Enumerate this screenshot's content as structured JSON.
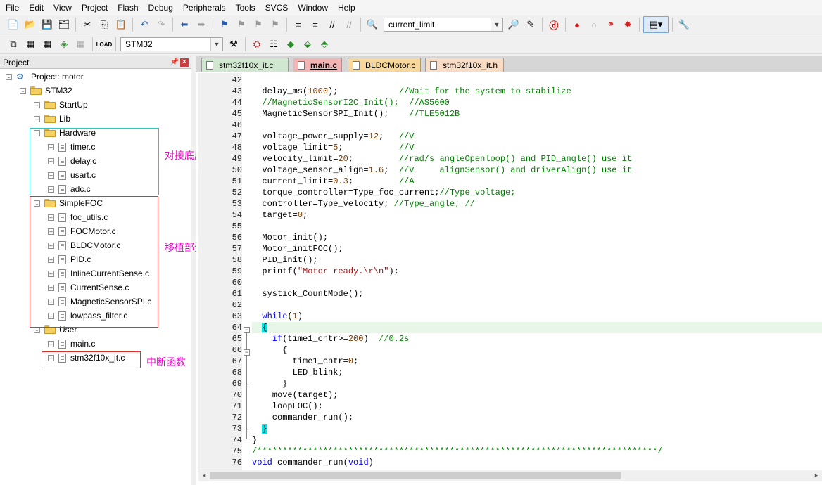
{
  "menu": [
    "File",
    "Edit",
    "View",
    "Project",
    "Flash",
    "Debug",
    "Peripherals",
    "Tools",
    "SVCS",
    "Window",
    "Help"
  ],
  "toolbar1": {
    "find_combo": "current_limit"
  },
  "toolbar2": {
    "target_combo": "STM32"
  },
  "project_panel": {
    "title": "Project",
    "tree": [
      {
        "label": "Project: motor",
        "kind": "project",
        "expander": "-"
      },
      {
        "label": "STM32",
        "kind": "target",
        "expander": "-"
      },
      {
        "label": "StartUp",
        "kind": "folder",
        "expander": "+"
      },
      {
        "label": "Lib",
        "kind": "folder",
        "expander": "+"
      },
      {
        "label": "Hardware",
        "kind": "folder",
        "expander": "-"
      },
      {
        "label": "timer.c",
        "kind": "file",
        "expander": "+"
      },
      {
        "label": "delay.c",
        "kind": "file",
        "expander": "+"
      },
      {
        "label": "usart.c",
        "kind": "file",
        "expander": "+"
      },
      {
        "label": "adc.c",
        "kind": "file",
        "expander": "+"
      },
      {
        "label": "SimpleFOC",
        "kind": "folder",
        "expander": "-"
      },
      {
        "label": "foc_utils.c",
        "kind": "file",
        "expander": "+"
      },
      {
        "label": "FOCMotor.c",
        "kind": "file",
        "expander": "+"
      },
      {
        "label": "BLDCMotor.c",
        "kind": "file",
        "expander": "+"
      },
      {
        "label": "PID.c",
        "kind": "file",
        "expander": "+"
      },
      {
        "label": "InlineCurrentSense.c",
        "kind": "file",
        "expander": "+"
      },
      {
        "label": "CurrentSense.c",
        "kind": "file",
        "expander": "+"
      },
      {
        "label": "MagneticSensorSPI.c",
        "kind": "file",
        "expander": "+"
      },
      {
        "label": "lowpass_filter.c",
        "kind": "file",
        "expander": "+"
      },
      {
        "label": "User",
        "kind": "folder",
        "expander": "-"
      },
      {
        "label": "main.c",
        "kind": "file",
        "expander": "+"
      },
      {
        "label": "stm32f10x_it.c",
        "kind": "file",
        "expander": "+"
      }
    ],
    "annotations": {
      "hardware": "对接底层",
      "simplefoc": "移植部分",
      "interrupt": "中断函数"
    }
  },
  "tabs": [
    {
      "label": "stm32f10x_it.c",
      "style": "green"
    },
    {
      "label": "main.c",
      "style": "active"
    },
    {
      "label": "BLDCMotor.c",
      "style": "orange"
    },
    {
      "label": "stm32f10x_it.h",
      "style": "peach"
    }
  ],
  "line_numbers": [
    "42",
    "43",
    "44",
    "45",
    "46",
    "47",
    "48",
    "49",
    "50",
    "51",
    "52",
    "53",
    "54",
    "55",
    "56",
    "57",
    "58",
    "59",
    "60",
    "61",
    "62",
    "63",
    "64",
    "65",
    "66",
    "67",
    "68",
    "69",
    "70",
    "71",
    "72",
    "73",
    "74",
    "75",
    "76"
  ],
  "code": [
    [],
    [
      [
        "  delay_ms(",
        ""
      ],
      [
        "1000",
        "num"
      ],
      [
        ");            ",
        ""
      ],
      [
        "//Wait for the system to stabilize",
        "cm"
      ]
    ],
    [
      [
        "  ",
        ""
      ],
      [
        "//MagneticSensorI2C_Init();  //AS5600",
        "cm"
      ]
    ],
    [
      [
        "  MagneticSensorSPI_Init();    ",
        ""
      ],
      [
        "//TLE5012B",
        "cm"
      ]
    ],
    [],
    [
      [
        "  voltage_power_supply=",
        ""
      ],
      [
        "12",
        "num"
      ],
      [
        ";   ",
        ""
      ],
      [
        "//V",
        "cm"
      ]
    ],
    [
      [
        "  voltage_limit=",
        ""
      ],
      [
        "5",
        "num"
      ],
      [
        ";           ",
        ""
      ],
      [
        "//V",
        "cm"
      ]
    ],
    [
      [
        "  velocity_limit=",
        ""
      ],
      [
        "20",
        "num"
      ],
      [
        ";         ",
        ""
      ],
      [
        "//rad/s angleOpenloop() and PID_angle() use it",
        "cm"
      ]
    ],
    [
      [
        "  voltage_sensor_align=",
        ""
      ],
      [
        "1.6",
        "num"
      ],
      [
        ";  ",
        ""
      ],
      [
        "//V     alignSensor() and driverAlign() use it",
        "cm"
      ]
    ],
    [
      [
        "  current_limit=",
        ""
      ],
      [
        "0.3",
        "num"
      ],
      [
        ";         ",
        ""
      ],
      [
        "//A",
        "cm"
      ]
    ],
    [
      [
        "  torque_controller=Type_foc_current;",
        ""
      ],
      [
        "//Type_voltage;",
        "cm"
      ]
    ],
    [
      [
        "  controller=Type_velocity; ",
        ""
      ],
      [
        "//Type_angle; //",
        "cm"
      ]
    ],
    [
      [
        "  target=",
        ""
      ],
      [
        "0",
        "num"
      ],
      [
        ";",
        ""
      ]
    ],
    [],
    [
      [
        "  Motor_init();",
        ""
      ]
    ],
    [
      [
        "  Motor_initFOC();",
        ""
      ]
    ],
    [
      [
        "  PID_init();",
        ""
      ]
    ],
    [
      [
        "  printf(",
        ""
      ],
      [
        "\"Motor ready.\\r\\n\"",
        "str"
      ],
      [
        ");",
        ""
      ]
    ],
    [],
    [
      [
        "  systick_CountMode();",
        ""
      ]
    ],
    [],
    [
      [
        "  ",
        ""
      ],
      [
        "while",
        "kw"
      ],
      [
        "(",
        ""
      ],
      [
        "1",
        "num"
      ],
      [
        ")",
        ""
      ]
    ],
    [
      [
        "  ",
        ""
      ],
      [
        "{",
        "brace"
      ]
    ],
    [
      [
        "    ",
        ""
      ],
      [
        "if",
        "kw"
      ],
      [
        "(time1_cntr>=",
        ""
      ],
      [
        "200",
        "num"
      ],
      [
        ")  ",
        ""
      ],
      [
        "//0.2s",
        "cm"
      ]
    ],
    [
      [
        "      {",
        ""
      ]
    ],
    [
      [
        "        time1_cntr=",
        ""
      ],
      [
        "0",
        "num"
      ],
      [
        ";",
        ""
      ]
    ],
    [
      [
        "        LED_blink;",
        ""
      ]
    ],
    [
      [
        "      }",
        ""
      ]
    ],
    [
      [
        "    move(target);",
        ""
      ]
    ],
    [
      [
        "    loopFOC();",
        ""
      ]
    ],
    [
      [
        "    commander_run();",
        ""
      ]
    ],
    [
      [
        "  ",
        ""
      ],
      [
        "}",
        "brace"
      ]
    ],
    [
      [
        "}",
        ""
      ]
    ],
    [
      [
        "/*******************************************************************************/",
        "cm"
      ]
    ],
    [
      [
        "void",
        "kw"
      ],
      [
        " commander_run(",
        ""
      ],
      [
        "void",
        "kw"
      ],
      [
        ")",
        ""
      ]
    ]
  ],
  "highlighted_line_index": 22
}
